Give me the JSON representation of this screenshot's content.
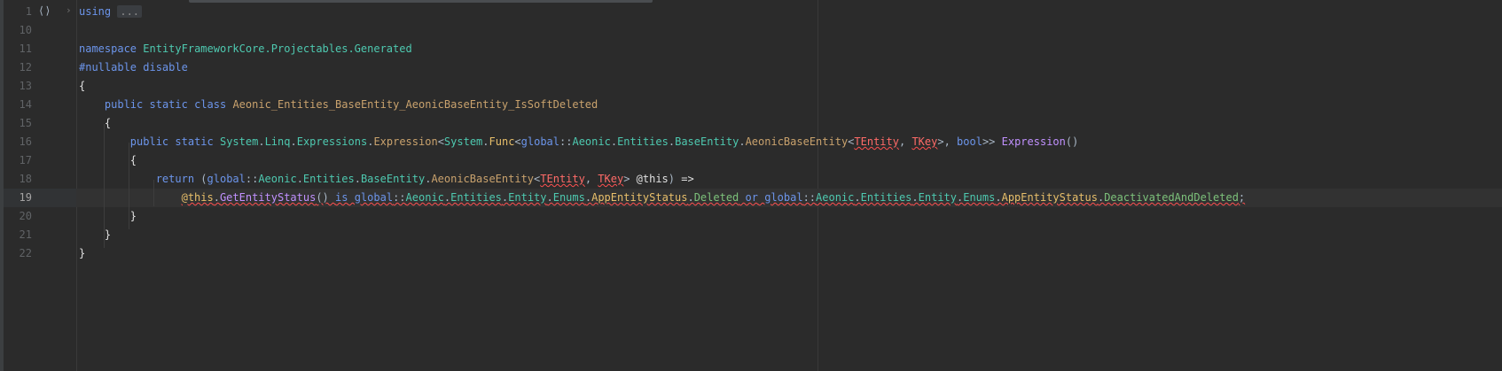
{
  "editor": {
    "fold_icon": "code-fold-icon",
    "collapsed_text": "...",
    "lines": [
      {
        "num": "1"
      },
      {
        "num": "10"
      },
      {
        "num": "11"
      },
      {
        "num": "12"
      },
      {
        "num": "13"
      },
      {
        "num": "14"
      },
      {
        "num": "15"
      },
      {
        "num": "16"
      },
      {
        "num": "17"
      },
      {
        "num": "18"
      },
      {
        "num": "19"
      },
      {
        "num": "20"
      },
      {
        "num": "21"
      },
      {
        "num": "22"
      }
    ],
    "tokens": {
      "using": "using",
      "namespace_kw": "namespace",
      "ns_name": "EntityFrameworkCore.Projectables.Generated",
      "nullable": "#nullable disable",
      "open_brace": "{",
      "close_brace": "}",
      "public": "public",
      "static": "static",
      "class": "class",
      "class_name": "Aeonic_Entities_BaseEntity_AeonicBaseEntity_IsSoftDeleted",
      "system": "System",
      "linq": "Linq",
      "expressions": "Expressions",
      "expression_type": "Expression",
      "func": "Func",
      "global": "global",
      "aeonic": "Aeonic",
      "entities": "Entities",
      "base_entity": "BaseEntity",
      "aeonic_base_entity": "AeonicBaseEntity",
      "tentity": "TEntity",
      "tkey": "TKey",
      "bool": "bool",
      "expression_method": "Expression",
      "return": "return",
      "this_param": "@this",
      "arrow": "=>",
      "get_status": "GetEntityStatus",
      "is": "is",
      "or": "or",
      "entity": "Entity",
      "enums": "Enums",
      "app_status": "AppEntityStatus",
      "deleted": "Deleted",
      "deactivated": "DeactivatedAndDeleted"
    }
  }
}
